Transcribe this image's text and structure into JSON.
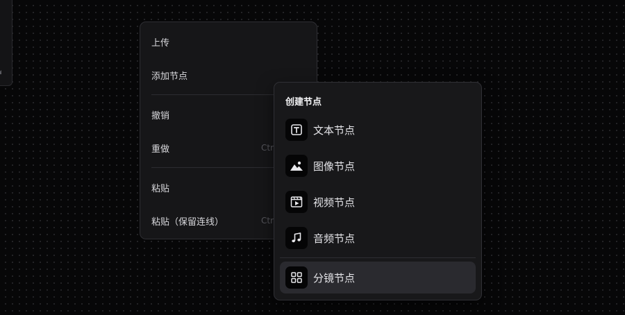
{
  "context_menu": {
    "items": [
      {
        "label": "上传",
        "shortcut": ""
      },
      {
        "label": "添加节点",
        "shortcut": ""
      },
      {
        "label": "撤销",
        "shortcut": ""
      },
      {
        "label": "重做",
        "shortcut": "Ctr"
      },
      {
        "label": "粘贴",
        "shortcut": ""
      },
      {
        "label": "粘贴（保留连线）",
        "shortcut": "Ctr"
      }
    ]
  },
  "submenu": {
    "title": "创建节点",
    "items": [
      {
        "label": "文本节点",
        "icon": "text-icon"
      },
      {
        "label": "图像节点",
        "icon": "image-icon"
      },
      {
        "label": "视频节点",
        "icon": "video-icon"
      },
      {
        "label": "音频节点",
        "icon": "music-icon"
      },
      {
        "label": "分镜节点",
        "icon": "grid-icon",
        "highlighted": true
      }
    ]
  },
  "colors": {
    "background": "#070708",
    "menu_background": "#161618",
    "highlight": "#2a2a2f",
    "text": "#e4e4e8",
    "muted_text": "#55555b"
  }
}
